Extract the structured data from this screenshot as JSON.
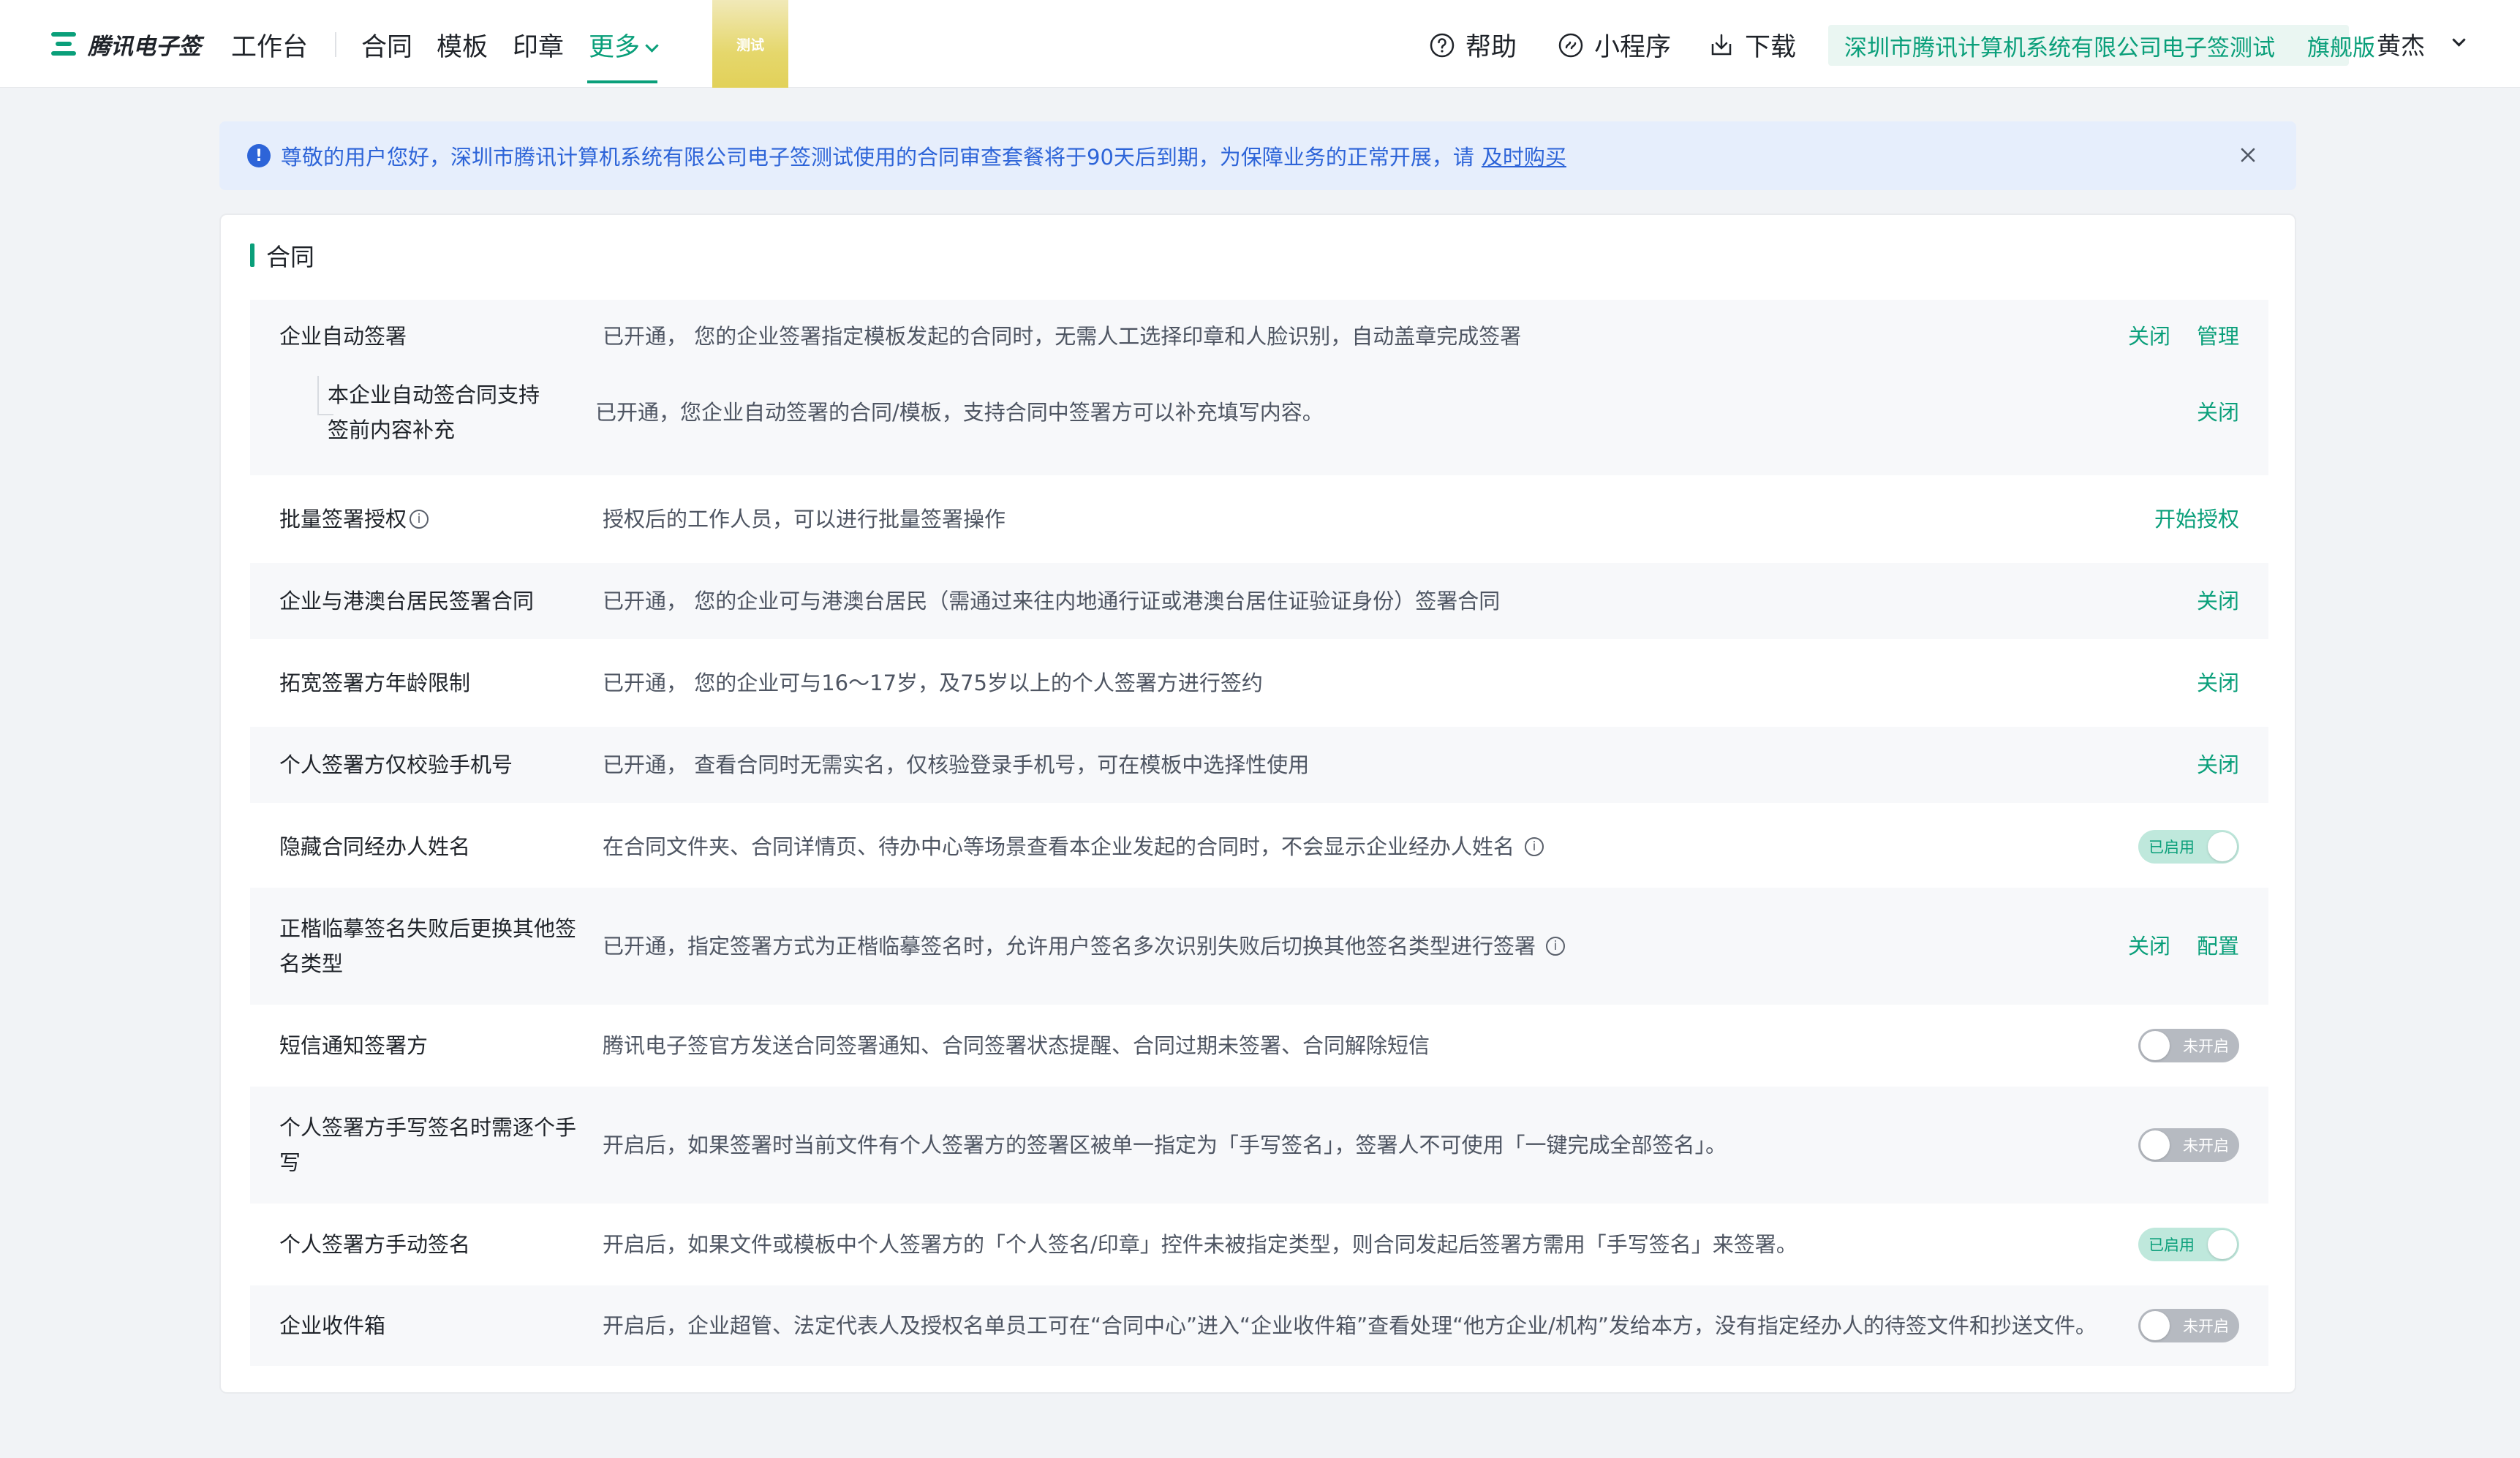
{
  "header": {
    "logo_text": "腾讯电子签",
    "nav": {
      "workbench": "工作台",
      "contract": "合同",
      "template": "模板",
      "seal": "印章",
      "more": "更多"
    },
    "test_tag": "测试",
    "help": "帮助",
    "mini_program": "小程序",
    "download": "下载",
    "company_name": "深圳市腾讯计算机系统有限公司电子签测试",
    "edition": "旗舰版",
    "user_name": "黄杰"
  },
  "notice": {
    "text": "尊敬的用户您好，深圳市腾讯计算机系统有限公司电子签测试使用的合同审查套餐将于90天后到期，为保障业务的正常开展，请",
    "link": "及时购买"
  },
  "section": {
    "title": "合同",
    "rows": [
      {
        "label": "企业自动签署",
        "desc": "已开通， 您的企业签署指定模板发起的合同时，无需人工选择印章和人脸识别，自动盖章完成签署",
        "actions": [
          "关闭",
          "管理"
        ]
      },
      {
        "label": "本企业自动签合同支持签前内容补充",
        "desc": "已开通，您企业自动签署的合同/模板，支持合同中签署方可以补充填写内容。",
        "actions": [
          "关闭"
        ]
      },
      {
        "label": "批量签署授权",
        "desc": "授权后的工作人员，可以进行批量签署操作",
        "actions": [
          "开始授权"
        ]
      },
      {
        "label": "企业与港澳台居民签署合同",
        "desc": "已开通， 您的企业可与港澳台居民（需通过来往内地通行证或港澳台居住证验证身份）签署合同",
        "actions": [
          "关闭"
        ]
      },
      {
        "label": "拓宽签署方年龄限制",
        "desc": "已开通， 您的企业可与16～17岁，及75岁以上的个人签署方进行签约",
        "actions": [
          "关闭"
        ]
      },
      {
        "label": "个人签署方仅校验手机号",
        "desc": "已开通， 查看合同时无需实名，仅核验登录手机号，可在模板中选择性使用",
        "actions": [
          "关闭"
        ]
      },
      {
        "label": "隐藏合同经办人姓名",
        "desc": "在合同文件夹、合同详情页、待办中心等场景查看本企业发起的合同时，不会显示企业经办人姓名",
        "toggle": "已启用"
      },
      {
        "label": "正楷临摹签名失败后更换其他签名类型",
        "desc": "已开通，指定签署方式为正楷临摹签名时，允许用户签名多次识别失败后切换其他签名类型进行签署",
        "actions": [
          "关闭",
          "配置"
        ]
      },
      {
        "label": "短信通知签署方",
        "desc": "腾讯电子签官方发送合同签署通知、合同签署状态提醒、合同过期未签署、合同解除短信",
        "toggle": "未开启"
      },
      {
        "label": "个人签署方手写签名时需逐个手写",
        "desc": "开启后，如果签署时当前文件有个人签署方的签署区被单一指定为「手写签名」，签署人不可使用「一键完成全部签名」。",
        "toggle": "未开启"
      },
      {
        "label": "个人签署方手动签名",
        "desc": "开启后，如果文件或模板中个人签署方的「个人签名/印章」控件未被指定类型，则合同发起后签署方需用「手写签名」来签署。",
        "toggle": "已启用"
      },
      {
        "label": "企业收件箱",
        "desc": "开启后，企业超管、法定代表人及授权名单员工可在“合同中心”进入“企业收件箱”查看处理“他方企业/机构”发给本方，没有指定经办人的待签文件和抄送文件。",
        "toggle": "未开启"
      }
    ]
  },
  "colors": {
    "accent": "#0a9f7a",
    "notice_blue": "#2d64d8",
    "notice_bg": "#e6eefc",
    "toggle_on_bg": "#bfe8dc",
    "toggle_off_bg": "#b6bac1"
  }
}
